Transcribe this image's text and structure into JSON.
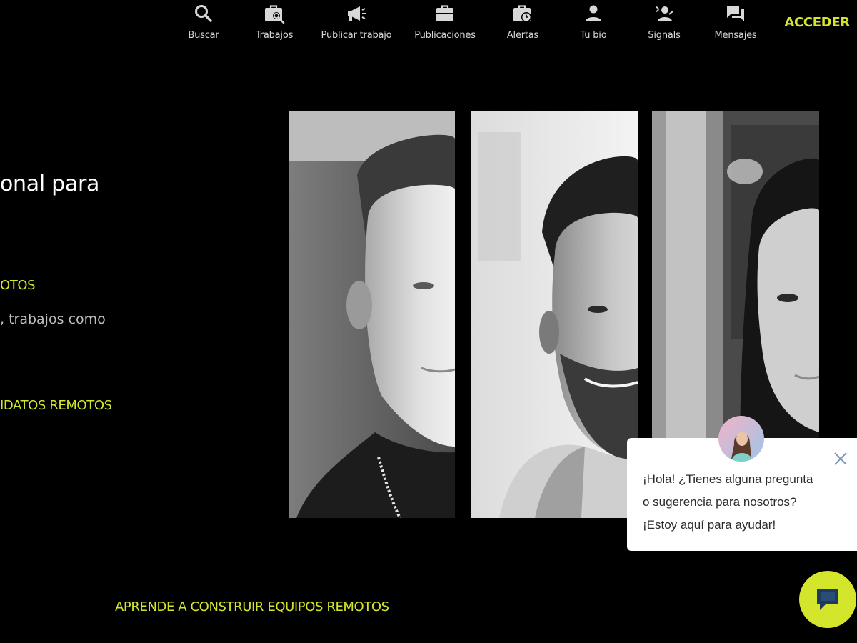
{
  "nav": {
    "items": [
      {
        "label": "Buscar",
        "icon": "search-icon"
      },
      {
        "label": "Trabajos",
        "icon": "briefcase-search-icon"
      },
      {
        "label": "Publicar trabajo",
        "icon": "megaphone-icon"
      },
      {
        "label": "Publicaciones",
        "icon": "briefcase-icon"
      },
      {
        "label": "Alertas",
        "icon": "briefcase-clock-icon"
      },
      {
        "label": "Tu bio",
        "icon": "person-icon"
      },
      {
        "label": "Signals",
        "icon": "person-signal-icon"
      },
      {
        "label": "Mensajes",
        "icon": "chat-forum-icon"
      }
    ],
    "login_label": "ACCEDER"
  },
  "hero": {
    "title_fragment": "onal para",
    "link_1": "OTOS",
    "subtitle_fragment": ", trabajos como",
    "link_2": "IDATOS REMOTOS",
    "bottom_link": "APRENDE A CONSTRUIR EQUIPOS REMOTOS"
  },
  "chat": {
    "lines": [
      "¡Hola! ¿Tienes alguna pregunta",
      "o sugerencia para nosotros?",
      "¡Estoy aquí para ayudar!"
    ]
  },
  "colors": {
    "background": "#000000",
    "accent": "#d4e62c",
    "nav_text": "#d8d8d8"
  }
}
